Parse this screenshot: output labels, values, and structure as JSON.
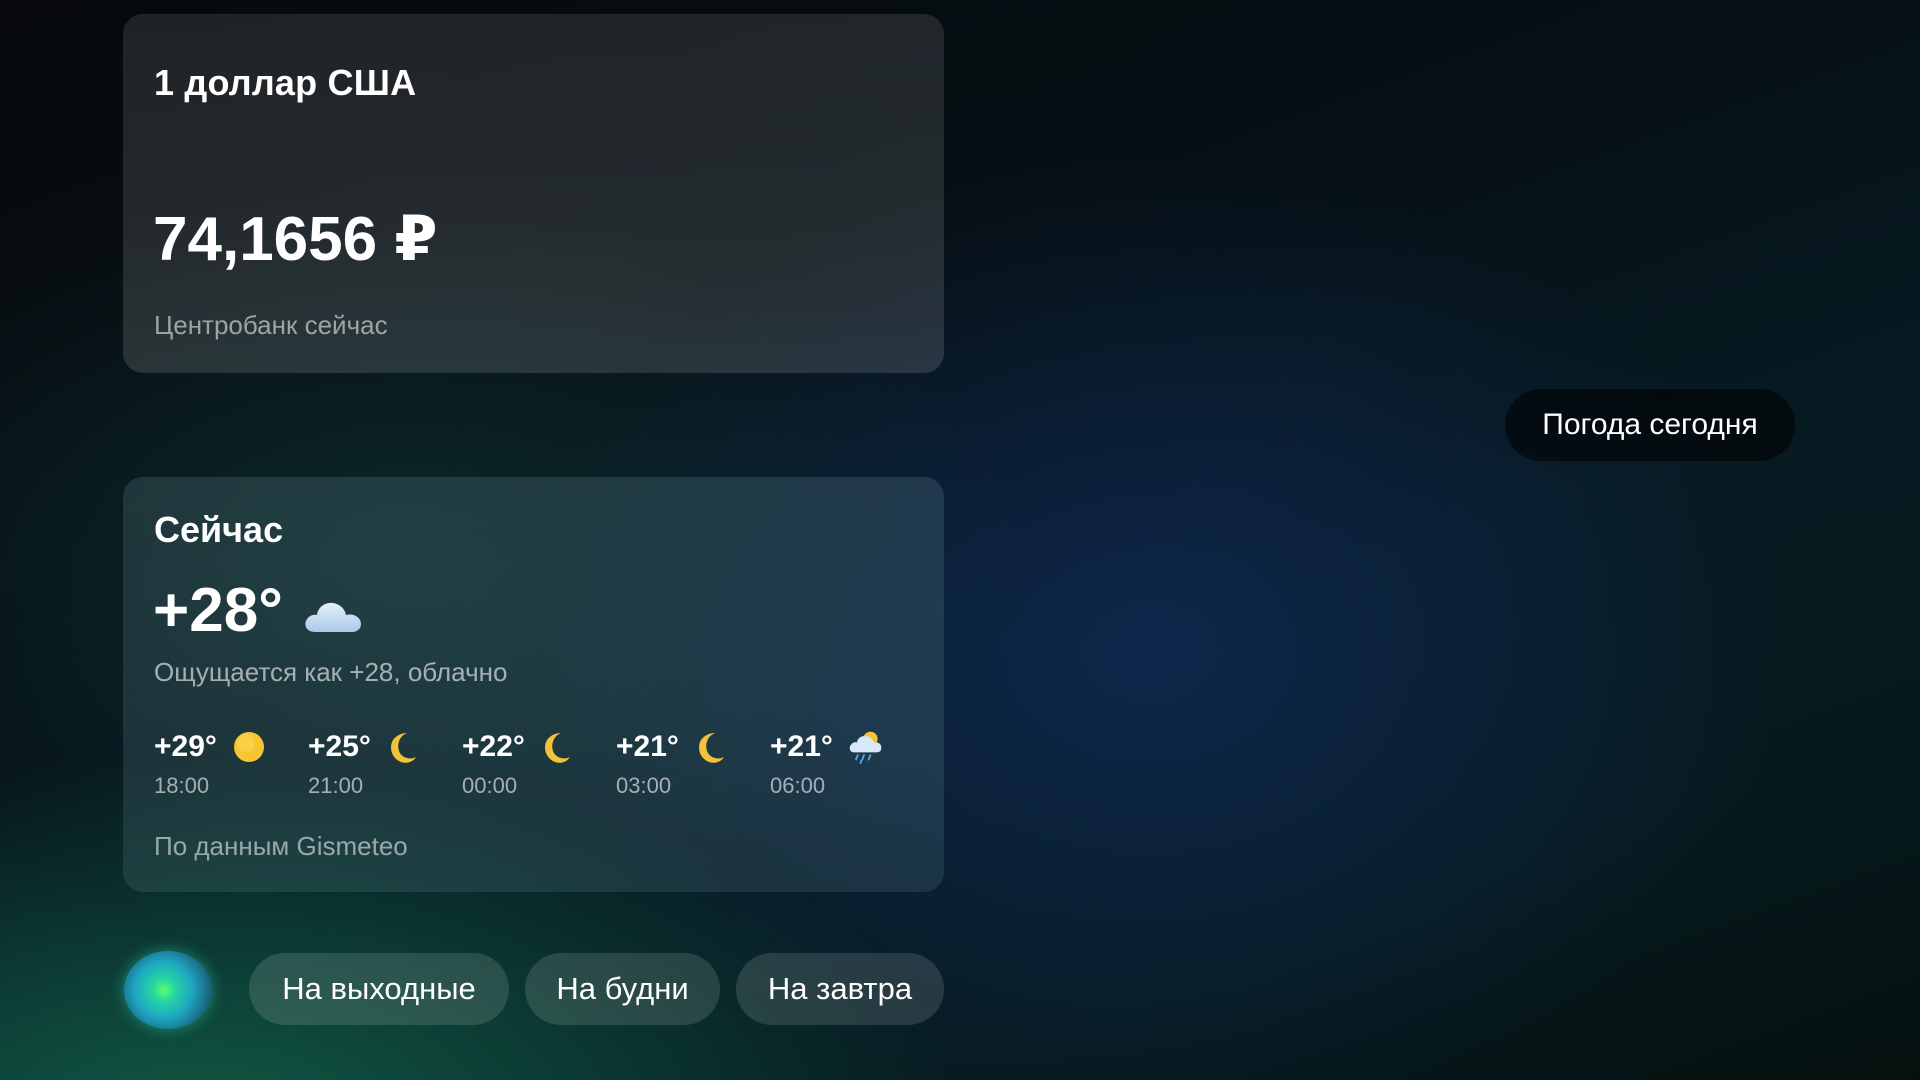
{
  "currency": {
    "title": "1 доллар США",
    "value": "74,1656 ₽",
    "source": "Центробанк сейчас"
  },
  "weather": {
    "title": "Сейчас",
    "temperature": "+28°",
    "icon": "cloud-icon",
    "description": "Ощущается как +28, облачно",
    "forecast": [
      {
        "temp": "+29°",
        "time": "18:00",
        "icon": "sun-icon"
      },
      {
        "temp": "+25°",
        "time": "21:00",
        "icon": "moon-icon"
      },
      {
        "temp": "+22°",
        "time": "00:00",
        "icon": "moon-icon"
      },
      {
        "temp": "+21°",
        "time": "03:00",
        "icon": "moon-icon"
      },
      {
        "temp": "+21°",
        "time": "06:00",
        "icon": "sun-cloud-rain-icon"
      }
    ],
    "source": "По данным Gismeteo"
  },
  "query_chip": "Погода сегодня",
  "suggestions": [
    "На выходные",
    "На будни",
    "На завтра"
  ],
  "colors": {
    "sun": "#f7c531",
    "moon": "#f2c23a",
    "cloud": "#cfe3f6"
  }
}
